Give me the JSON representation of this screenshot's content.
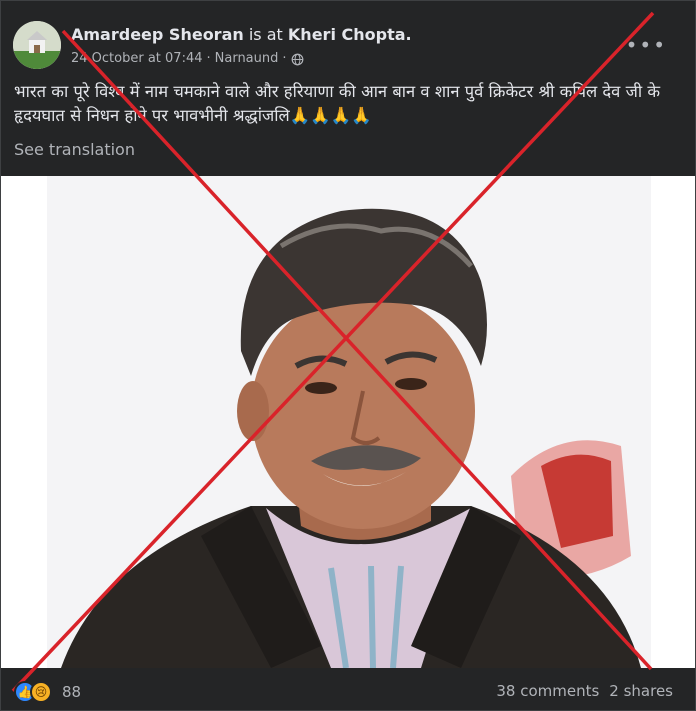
{
  "post": {
    "author": "Amardeep Sheoran",
    "is_at": "is at",
    "place": "Kheri Chopta.",
    "date": "24 October at 07:44",
    "location": "Narnaund",
    "separator": "·",
    "more_icon": "ellipsis-icon",
    "privacy_icon": "globe-icon",
    "caption": "भारत का पूरे विश्व में नाम चमकाने वाले और हरियाणा की आन बान व शान पुर्व क्रिकेटर श्री कपिल देव जी के हृदयघात से निधन होने पर भावभीनी श्रद्धांजलि🙏🙏🙏🙏",
    "see_translation": "See translation"
  },
  "footer": {
    "reaction_count": "88",
    "comments": "38 comments",
    "shares": "2 shares"
  },
  "colors": {
    "background": "#242526",
    "text": "#e4e6eb",
    "muted": "#b0b3b8",
    "cross": "#d9232a",
    "like": "#2d88ff"
  }
}
